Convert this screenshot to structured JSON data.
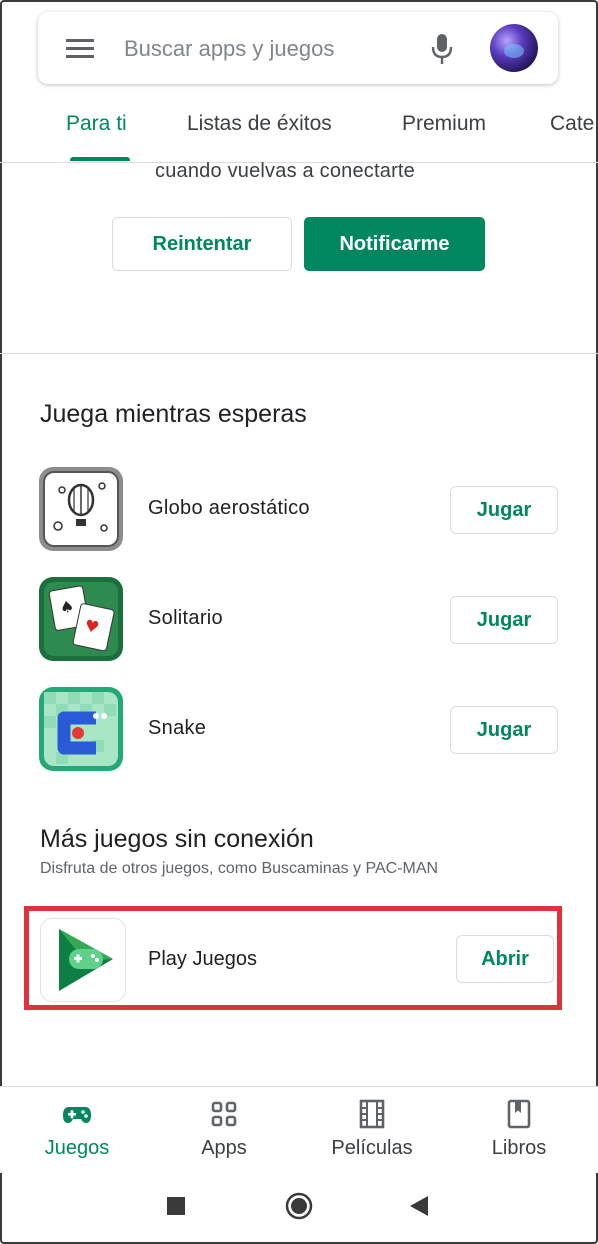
{
  "search": {
    "placeholder": "Buscar apps y juegos"
  },
  "tabs": [
    {
      "label": "Para ti",
      "active": true
    },
    {
      "label": "Listas de éxitos"
    },
    {
      "label": "Premium"
    },
    {
      "label": "Cate"
    }
  ],
  "offline": {
    "message": "cuando vuelvas a conectarte",
    "retry_label": "Reintentar",
    "notify_label": "Notificarme"
  },
  "play_while_waiting": {
    "title": "Juega mientras esperas",
    "games": [
      {
        "name": "Globo aerostático",
        "button": "Jugar",
        "icon": "hot-air-balloon-icon"
      },
      {
        "name": "Solitario",
        "button": "Jugar",
        "icon": "solitaire-cards-icon"
      },
      {
        "name": "Snake",
        "button": "Jugar",
        "icon": "snake-game-icon"
      }
    ]
  },
  "more_offline_games": {
    "title": "Más juegos sin conexión",
    "subtitle": "Disfruta de otros juegos, como Buscaminas y PAC-MAN",
    "app": {
      "name": "Play Juegos",
      "button": "Abrir",
      "icon": "play-games-icon"
    }
  },
  "bottom_nav": [
    {
      "label": "Juegos",
      "icon": "gamepad-icon",
      "active": true
    },
    {
      "label": "Apps",
      "icon": "apps-grid-icon"
    },
    {
      "label": "Películas",
      "icon": "film-icon"
    },
    {
      "label": "Libros",
      "icon": "bookmark-icon"
    }
  ],
  "colors": {
    "accent": "#01875f",
    "highlight": "#e0323c",
    "divider": "#dadce0"
  }
}
